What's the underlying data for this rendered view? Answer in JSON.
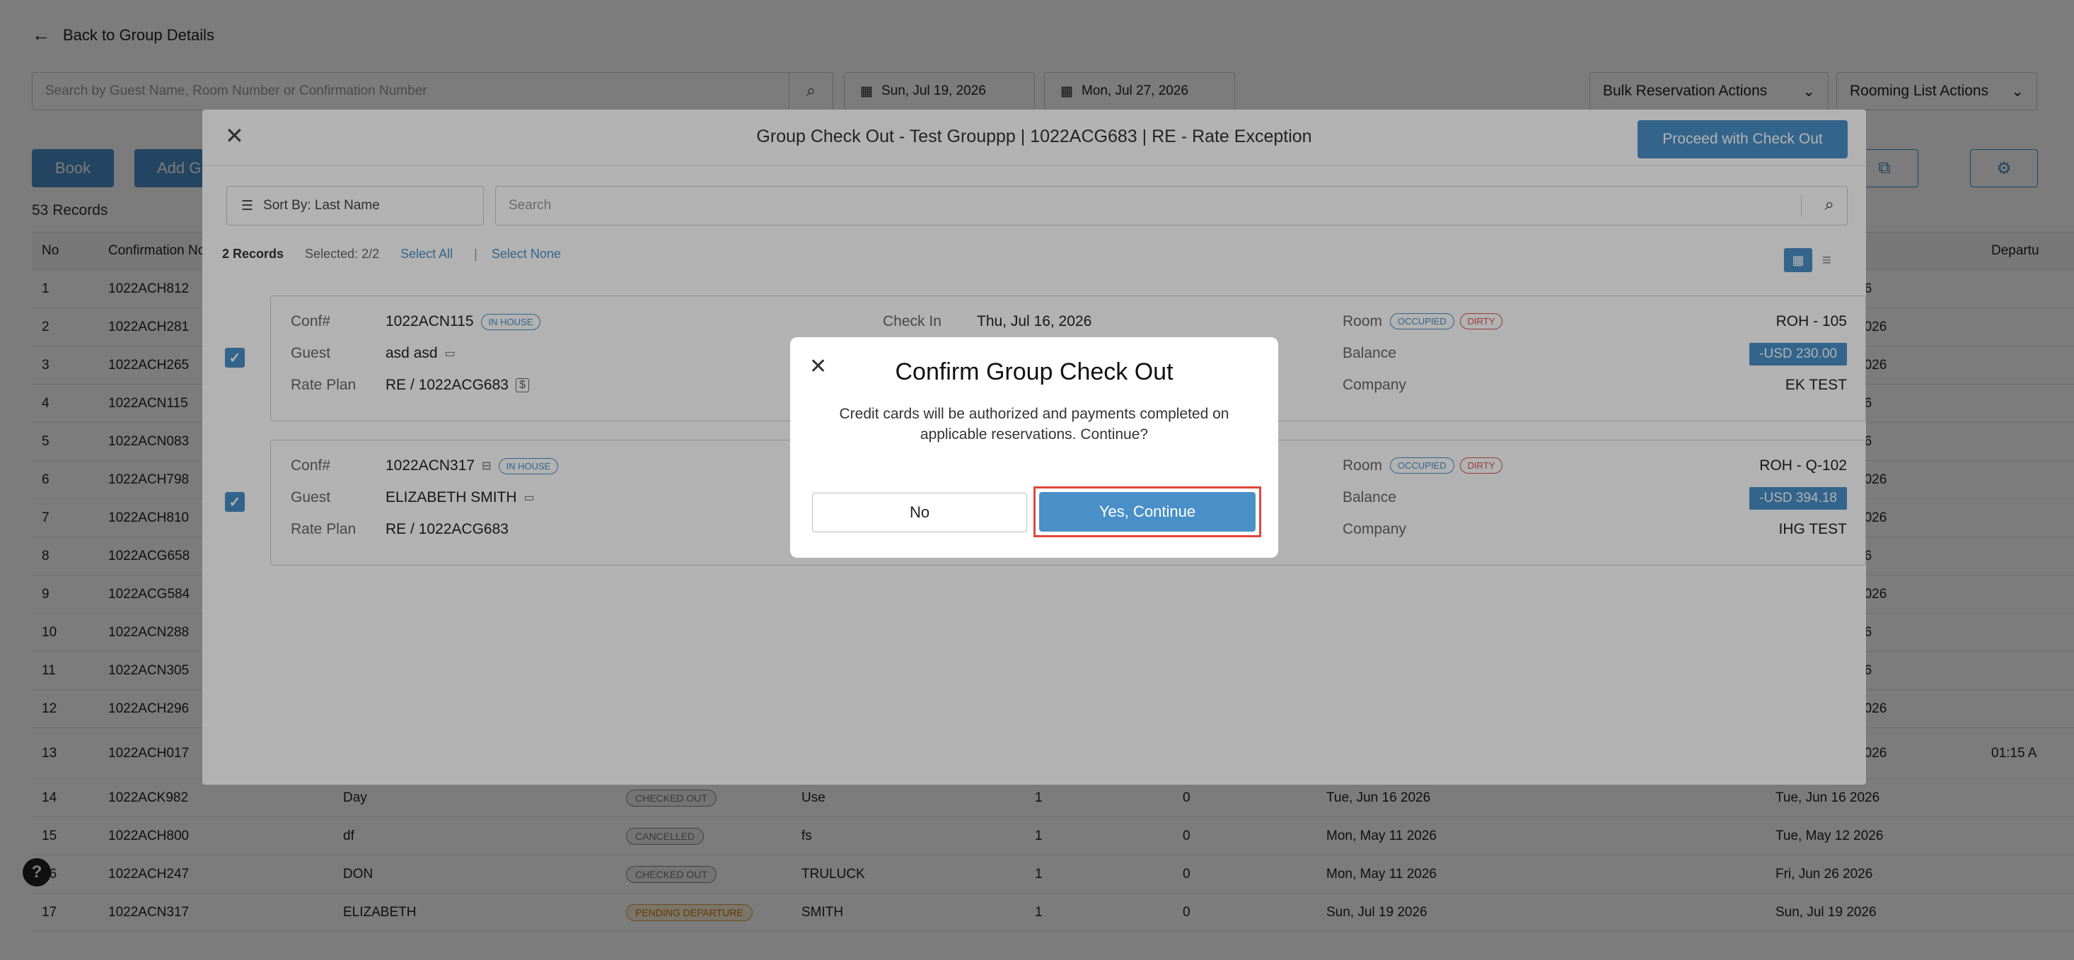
{
  "page": {
    "back_label": "Back to Group Details",
    "search_placeholder": "Search by Guest Name, Room Number or Confirmation Number",
    "date_from": "Sun, Jul 19, 2026",
    "date_to": "Mon, Jul 27, 2026",
    "bulk_actions": "Bulk Reservation Actions",
    "rooming_actions": "Rooming List Actions",
    "book_label": "Book",
    "add_label": "Add G",
    "records_count": "53 Records",
    "columns": {
      "no": "No",
      "conf": "Confirmation No",
      "departure": "Departu"
    },
    "rows": [
      {
        "no": "1",
        "conf": "1022ACH812",
        "date2": "26"
      },
      {
        "no": "2",
        "conf": "1022ACH281",
        "date2": "2026"
      },
      {
        "no": "3",
        "conf": "1022ACH265",
        "date2": "2026"
      },
      {
        "no": "4",
        "conf": "1022ACN115",
        "date2": "26"
      },
      {
        "no": "5",
        "conf": "1022ACN083",
        "date2": "26"
      },
      {
        "no": "6",
        "conf": "1022ACH798",
        "date2": "2026"
      },
      {
        "no": "7",
        "conf": "1022ACH810",
        "date2": "2026"
      },
      {
        "no": "8",
        "conf": "1022ACG658",
        "date2": "26"
      },
      {
        "no": "9",
        "conf": "1022ACG584",
        "date2": "2026"
      },
      {
        "no": "10",
        "conf": "1022ACN288",
        "date2": "26"
      },
      {
        "no": "11",
        "conf": "1022ACN305",
        "date2": "26"
      },
      {
        "no": "12",
        "conf": "1022ACH296",
        "date2": "2026"
      },
      {
        "no": "13",
        "conf": "1022ACH017",
        "date2": "2026",
        "time": "01:15 A"
      },
      {
        "no": "14",
        "conf": "1022ACK982",
        "name": "Day",
        "status": "CHECKED OUT",
        "last": "Use",
        "a": "1",
        "b": "0",
        "arr": "Tue, Jun 16 2026",
        "dep": "Tue, Jun 16 2026"
      },
      {
        "no": "15",
        "conf": "1022ACH800",
        "name": "df",
        "status": "CANCELLED",
        "last": "fs",
        "a": "1",
        "b": "0",
        "arr": "Mon, May 11 2026",
        "dep": "Tue, May 12 2026"
      },
      {
        "no": "16",
        "conf": "1022ACH247",
        "name": "DON",
        "status": "CHECKED OUT",
        "last": "TRULUCK",
        "a": "1",
        "b": "0",
        "arr": "Mon, May 11 2026",
        "dep": "Fri, Jun 26 2026"
      },
      {
        "no": "17",
        "conf": "1022ACN317",
        "name": "ELIZABETH",
        "status": "PENDING DEPARTURE",
        "last": "SMITH",
        "a": "1",
        "b": "0",
        "arr": "Sun, Jul 19 2026",
        "dep": "Sun, Jul 19 2026"
      }
    ]
  },
  "group_modal": {
    "title": "Group Check Out - Test Grouppp | 1022ACG683 | RE - Rate Exception",
    "proceed_label": "Proceed with Check Out",
    "sort_label": "Sort By: Last Name",
    "search_placeholder": "Search",
    "records": "2 Records",
    "selected": "Selected: 2/2",
    "select_all": "Select All",
    "divider": "|",
    "select_none": "Select None",
    "labels": {
      "conf": "Conf#",
      "guest": "Guest",
      "rate_plan": "Rate Plan",
      "check_in": "Check In",
      "room": "Room",
      "balance": "Balance",
      "company": "Company"
    },
    "reservations": [
      {
        "conf": "1022ACN115",
        "status": "IN HOUSE",
        "guest": "asd asd",
        "rate_plan": "RE / 1022ACG683",
        "rate_badge": "$",
        "check_in": "Thu, Jul 16, 2026",
        "room_tag1": "OCCUPIED",
        "room_tag2": "DIRTY",
        "room": "ROH - 105",
        "balance": "-USD 230.00",
        "company": "EK TEST"
      },
      {
        "conf": "1022ACN317",
        "status": "IN HOUSE",
        "guest": "ELIZABETH SMITH",
        "rate_plan": "RE / 1022ACG683",
        "room_tag1": "OCCUPIED",
        "room_tag2": "DIRTY",
        "room": "ROH - Q-102",
        "balance": "-USD 394.18",
        "company": "IHG TEST"
      }
    ]
  },
  "confirm_dialog": {
    "title": "Confirm Group Check Out",
    "body": "Credit cards will be authorized and payments completed on applicable reservations. Continue?",
    "no_label": "No",
    "yes_label": "Yes, Continue"
  },
  "colors": {
    "primary": "#4a90c8",
    "highlight_border": "#e0473a",
    "overlay": "rgba(0,0,0,0.30)"
  },
  "icons": [
    "back-arrow-icon",
    "search-icon",
    "calendar-icon",
    "chevron-down-icon",
    "close-icon",
    "sort-icon",
    "checkbox-checked-icon",
    "grid-view-icon",
    "list-view-icon",
    "external-link-icon",
    "gear-icon",
    "help-icon",
    "id-card-icon",
    "notes-icon"
  ]
}
